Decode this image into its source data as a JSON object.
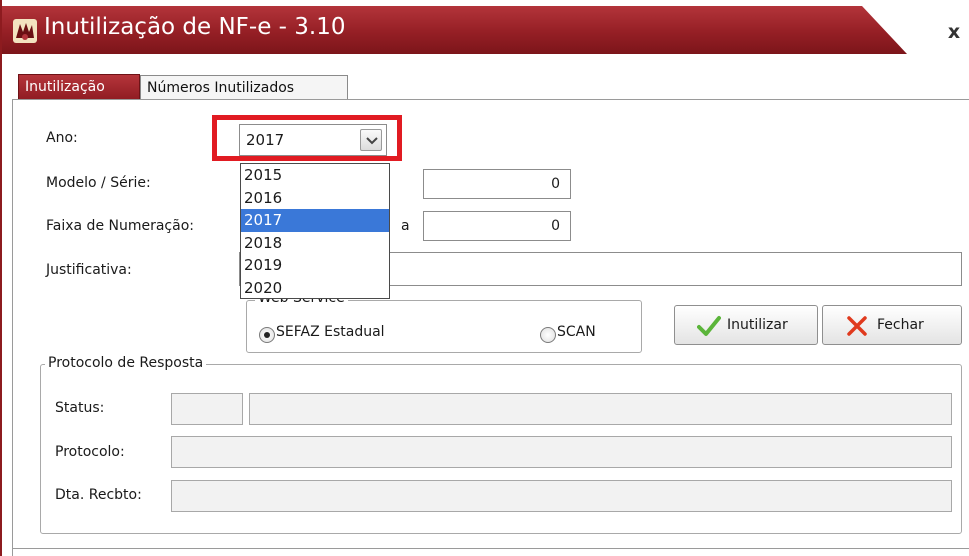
{
  "window": {
    "title": "Inutilização de NF-e - 3.10",
    "app_icon": "app-logo-icon",
    "close_symbol": "x"
  },
  "tabs": [
    {
      "label": "Inutilização",
      "active": true
    },
    {
      "label": "Números Inutilizados",
      "active": false
    }
  ],
  "form": {
    "ano_label": "Ano:",
    "ano_value": "2017",
    "ano_options": [
      "2015",
      "2016",
      "2017",
      "2018",
      "2019",
      "2020"
    ],
    "ano_selected": "2017",
    "modelo_label": "Modelo / Série:",
    "serie_value": "0",
    "faixa_label": "Faixa de Numeração:",
    "faixa_separator": "a",
    "faixa_fim_value": "0",
    "justificativa_label": "Justificativa:",
    "justificativa_value": ""
  },
  "webservice": {
    "title": "Web Service",
    "options": [
      {
        "label": "SEFAZ Estadual",
        "checked": true
      },
      {
        "label": "SCAN",
        "checked": false
      }
    ]
  },
  "buttons": {
    "inutilizar": "Inutilizar",
    "fechar": "Fechar"
  },
  "protocolo": {
    "title": "Protocolo de Resposta",
    "status_label": "Status:",
    "status_code": "",
    "status_text": "",
    "protocolo_label": "Protocolo:",
    "protocolo_value": "",
    "data_label": "Dta. Recbto:",
    "data_value": ""
  },
  "colors": {
    "brand_red": "#951f25",
    "highlight": "#e11b22",
    "selection": "#3a78d8"
  }
}
